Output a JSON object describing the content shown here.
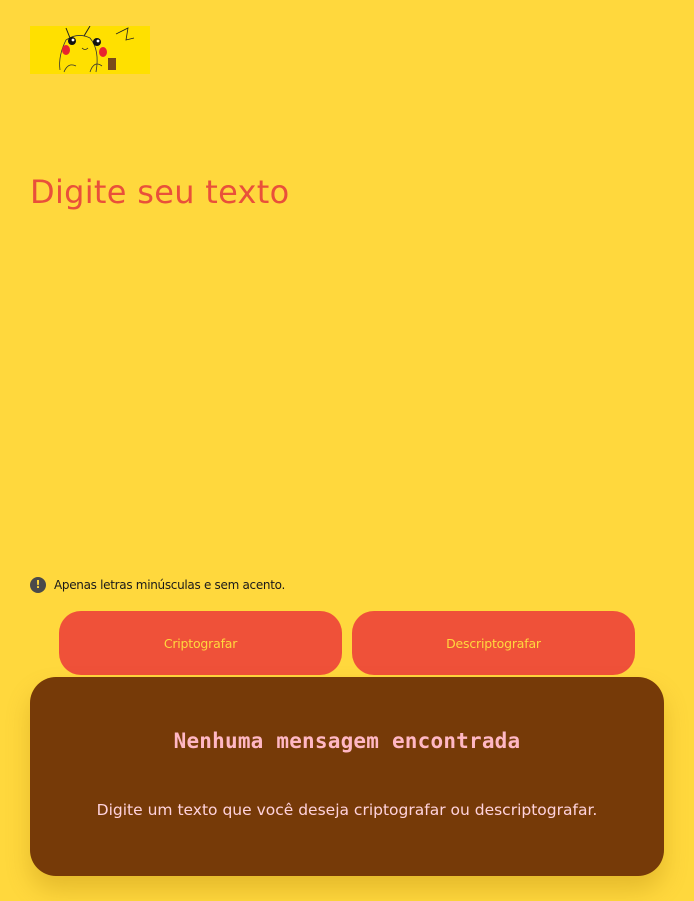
{
  "logo": {
    "icon": "pikachu-logo"
  },
  "input": {
    "placeholder": "Digite seu texto"
  },
  "hint": {
    "icon": "exclamation-circle-icon",
    "text": "Apenas letras minúsculas e sem acento."
  },
  "buttons": {
    "encrypt": "Criptografar",
    "decrypt": "Descriptografar"
  },
  "output": {
    "title": "Nenhuma mensagem encontrada",
    "description": "Digite um texto que você deseja criptografar ou descriptografar."
  },
  "colors": {
    "background": "#ffd83d",
    "accent": "#ef5139",
    "panel": "#763a08",
    "panel_title": "#ffb7c4",
    "panel_text": "#ffd2dc"
  }
}
